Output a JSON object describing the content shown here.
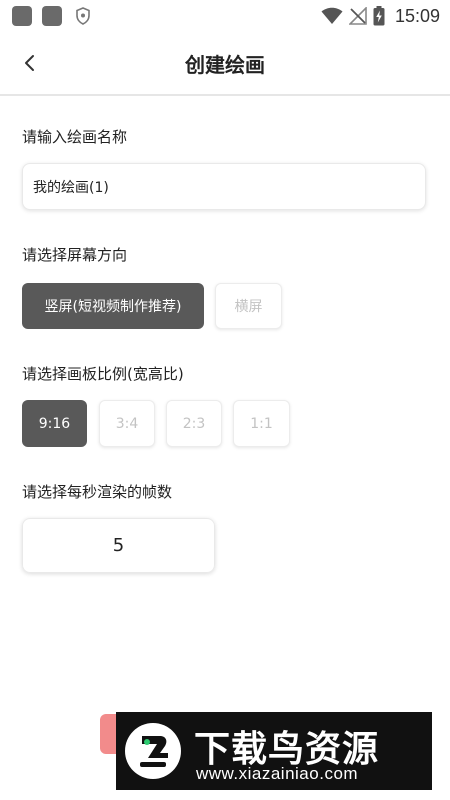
{
  "status_bar": {
    "time": "15:09"
  },
  "header": {
    "title": "创建绘画"
  },
  "form": {
    "name_label": "请输入绘画名称",
    "name_value": "我的绘画(1)",
    "orientation_label": "请选择屏幕方向",
    "orientation_options": [
      {
        "label": "竖屏(短视频制作推荐)",
        "selected": true
      },
      {
        "label": "横屏",
        "selected": false
      }
    ],
    "ratio_label": "请选择画板比例(宽高比)",
    "ratio_options": [
      {
        "label": "9:16",
        "selected": true
      },
      {
        "label": "3:4",
        "selected": false
      },
      {
        "label": "2:3",
        "selected": false
      },
      {
        "label": "1:1",
        "selected": false
      }
    ],
    "fps_label": "请选择每秒渲染的帧数",
    "fps_value": "5"
  },
  "watermark": {
    "title": "下载鸟资源",
    "url": "www.xiazainiao.com"
  },
  "colors": {
    "selected_chip": "#595959",
    "unselected_text": "#c3c3c3",
    "accent_pink": "#f28b8b",
    "watermark_bg": "#111111"
  }
}
